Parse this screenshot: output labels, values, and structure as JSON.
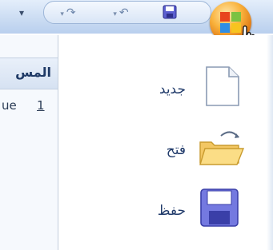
{
  "quick_access": {
    "dropdown_glyph": "▾",
    "undo_glyph": "↶",
    "redo_glyph": "↷",
    "undo_dropdown_glyph": "▾",
    "redo_dropdown_glyph": "▾"
  },
  "left_pane": {
    "header": "المس",
    "row_text": "ue",
    "row_number": "1"
  },
  "office_menu": {
    "items": [
      {
        "label": "جديد",
        "icon": "new-document-icon"
      },
      {
        "label": "فتح",
        "icon": "open-folder-icon"
      },
      {
        "label": "حفظ",
        "icon": "save-disk-icon"
      }
    ]
  },
  "colors": {
    "ribbon_top": "#c9dbf2",
    "office_button": "#f9b23c",
    "menu_text": "#203a6a"
  }
}
